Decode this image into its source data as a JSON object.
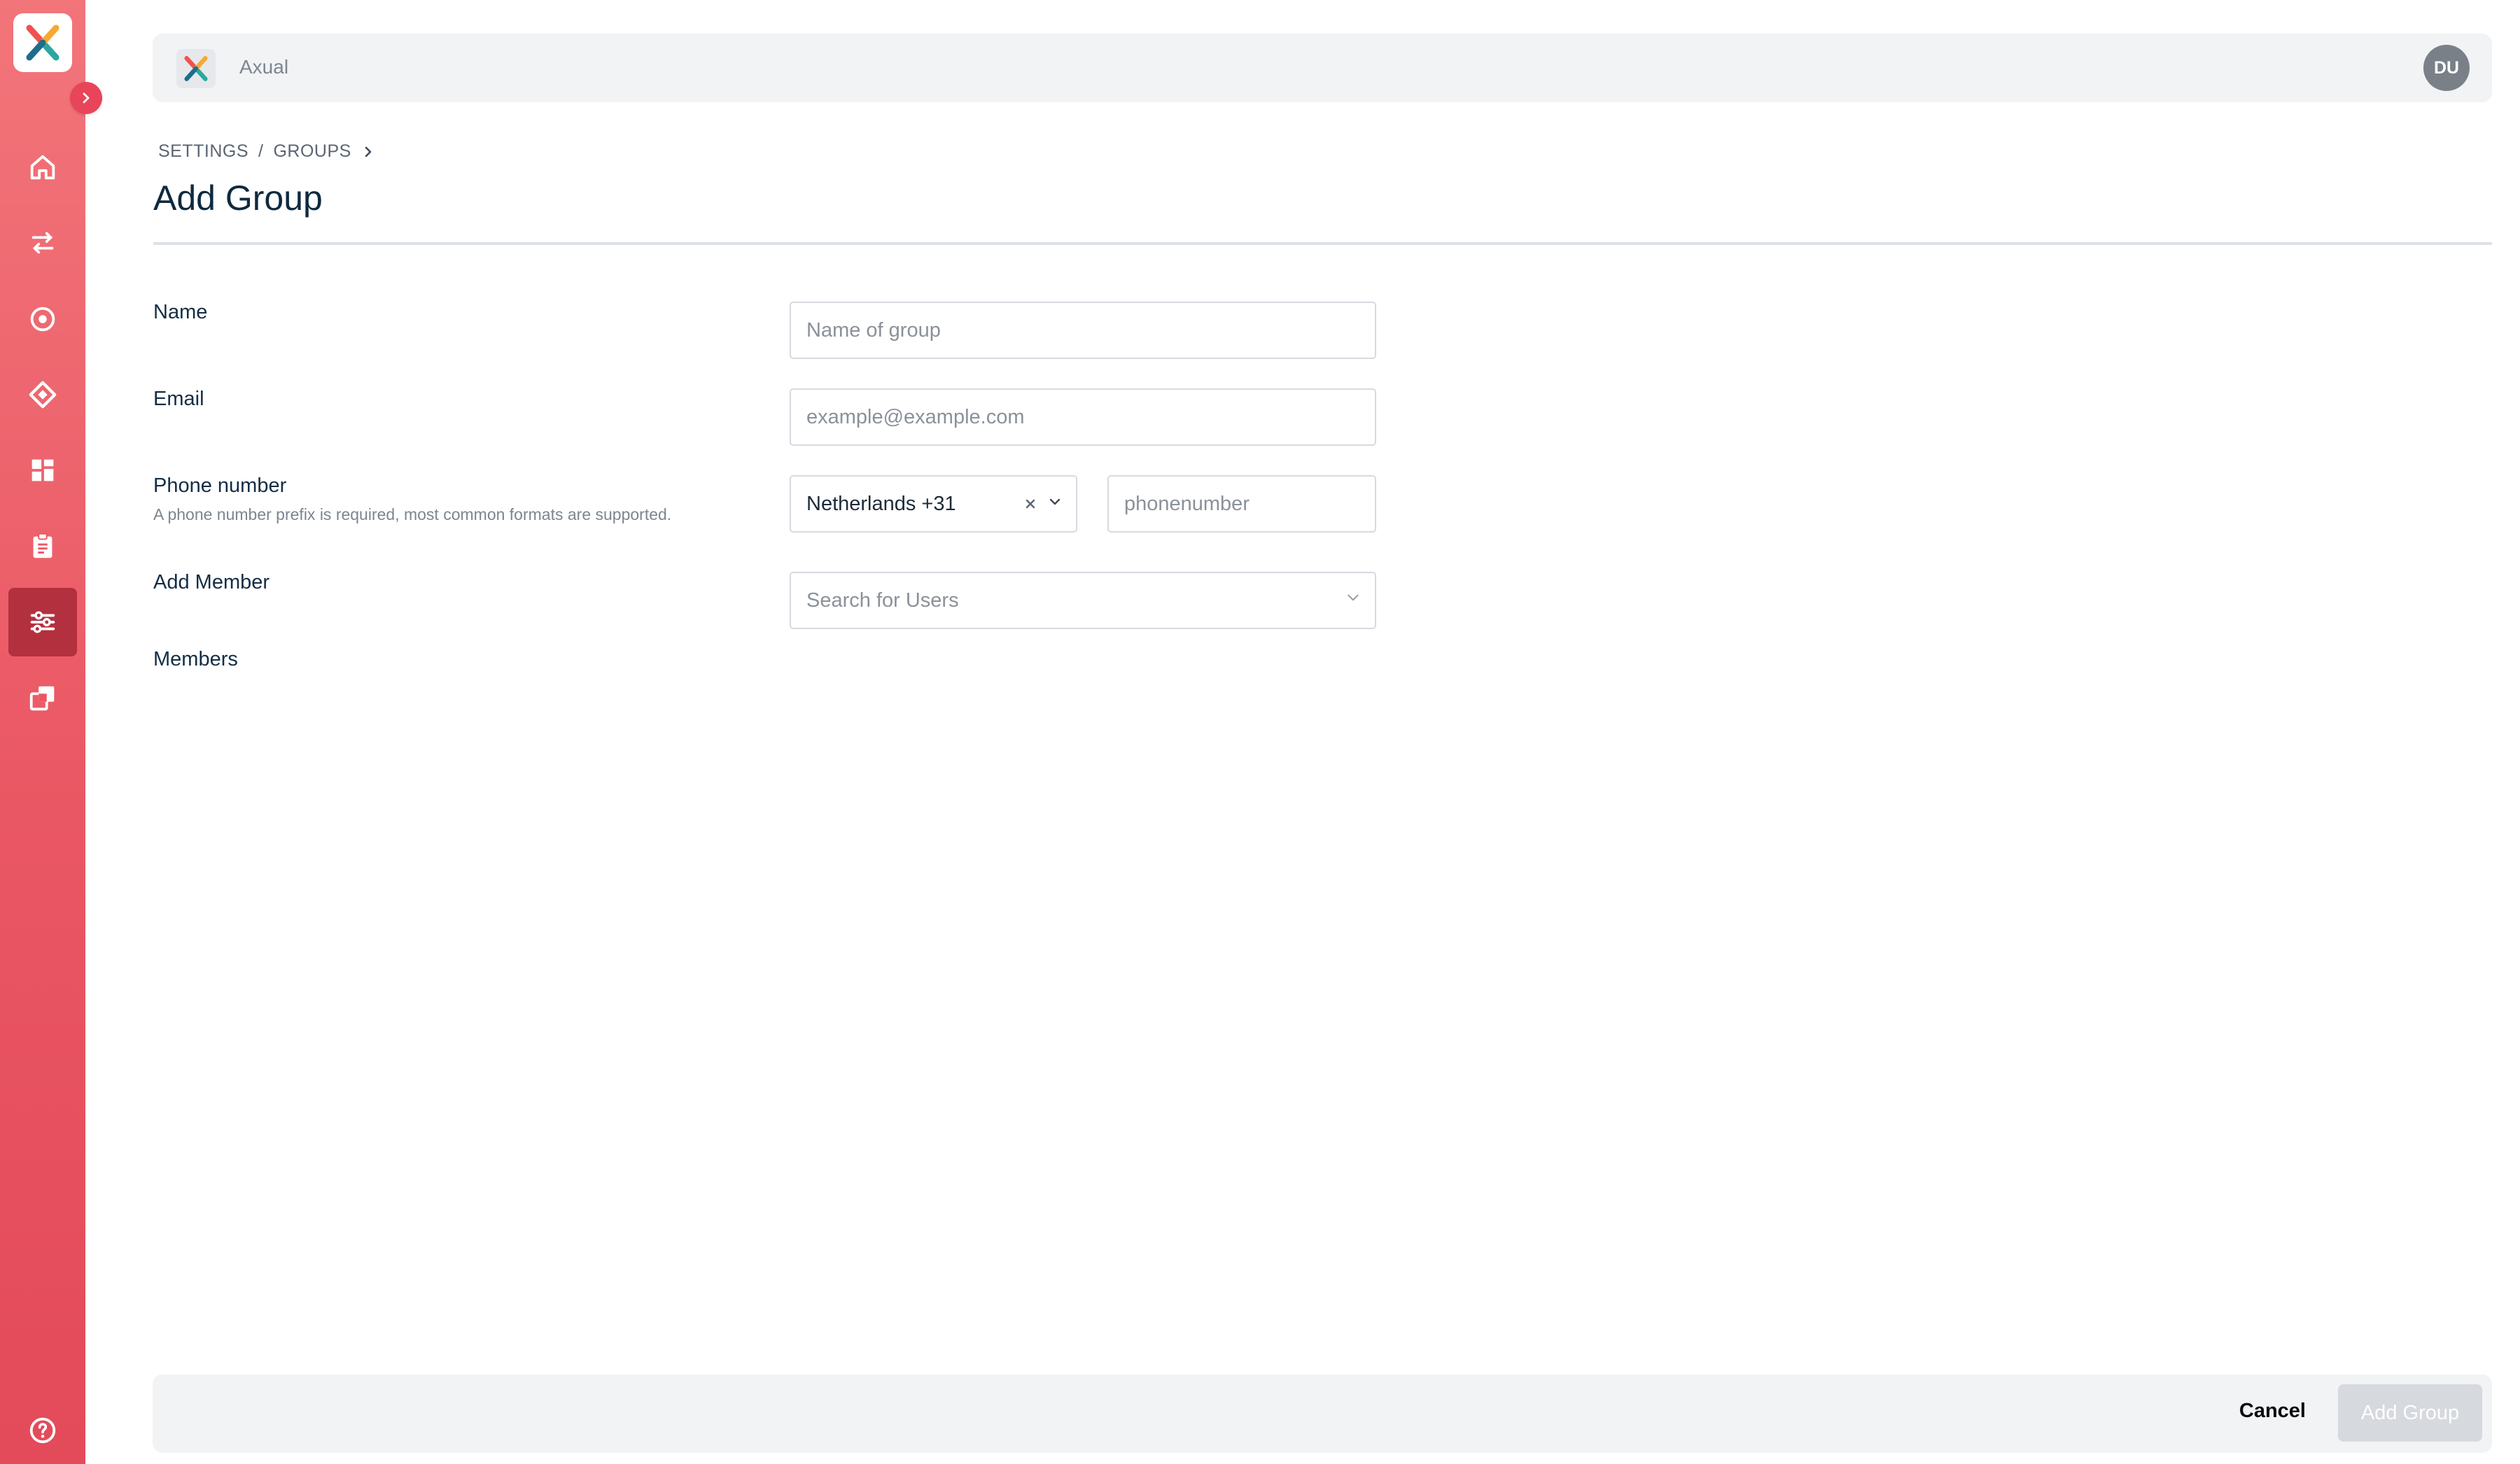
{
  "app": {
    "brand_name": "Axual",
    "user_initials": "DU",
    "accent_color": "#e8455a"
  },
  "sidebar": {
    "items": [
      {
        "name": "home",
        "icon": "home-icon"
      },
      {
        "name": "streams",
        "icon": "arrows-exchange-icon"
      },
      {
        "name": "applications",
        "icon": "target-icon"
      },
      {
        "name": "environments",
        "icon": "diamond-icon"
      },
      {
        "name": "dashboard",
        "icon": "grid-icon"
      },
      {
        "name": "approvals",
        "icon": "clipboard-icon"
      },
      {
        "name": "settings",
        "icon": "sliders-icon",
        "active": true
      },
      {
        "name": "libraries",
        "icon": "copy-icon"
      }
    ],
    "help_icon": "help-icon"
  },
  "breadcrumb": {
    "items": [
      "SETTINGS",
      "GROUPS"
    ],
    "separator": "/"
  },
  "page": {
    "title": "Add Group"
  },
  "form": {
    "name": {
      "label": "Name",
      "placeholder": "Name of group"
    },
    "email": {
      "label": "Email",
      "placeholder": "example@example.com"
    },
    "phone": {
      "label": "Phone number",
      "help": "A phone number prefix is required, most common formats are supported.",
      "country_value": "Netherlands +31",
      "number_placeholder": "phonenumber"
    },
    "add_member": {
      "label": "Add Member",
      "placeholder": "Search for Users"
    },
    "members": {
      "label": "Members"
    }
  },
  "footer": {
    "cancel_label": "Cancel",
    "submit_label": "Add Group"
  }
}
